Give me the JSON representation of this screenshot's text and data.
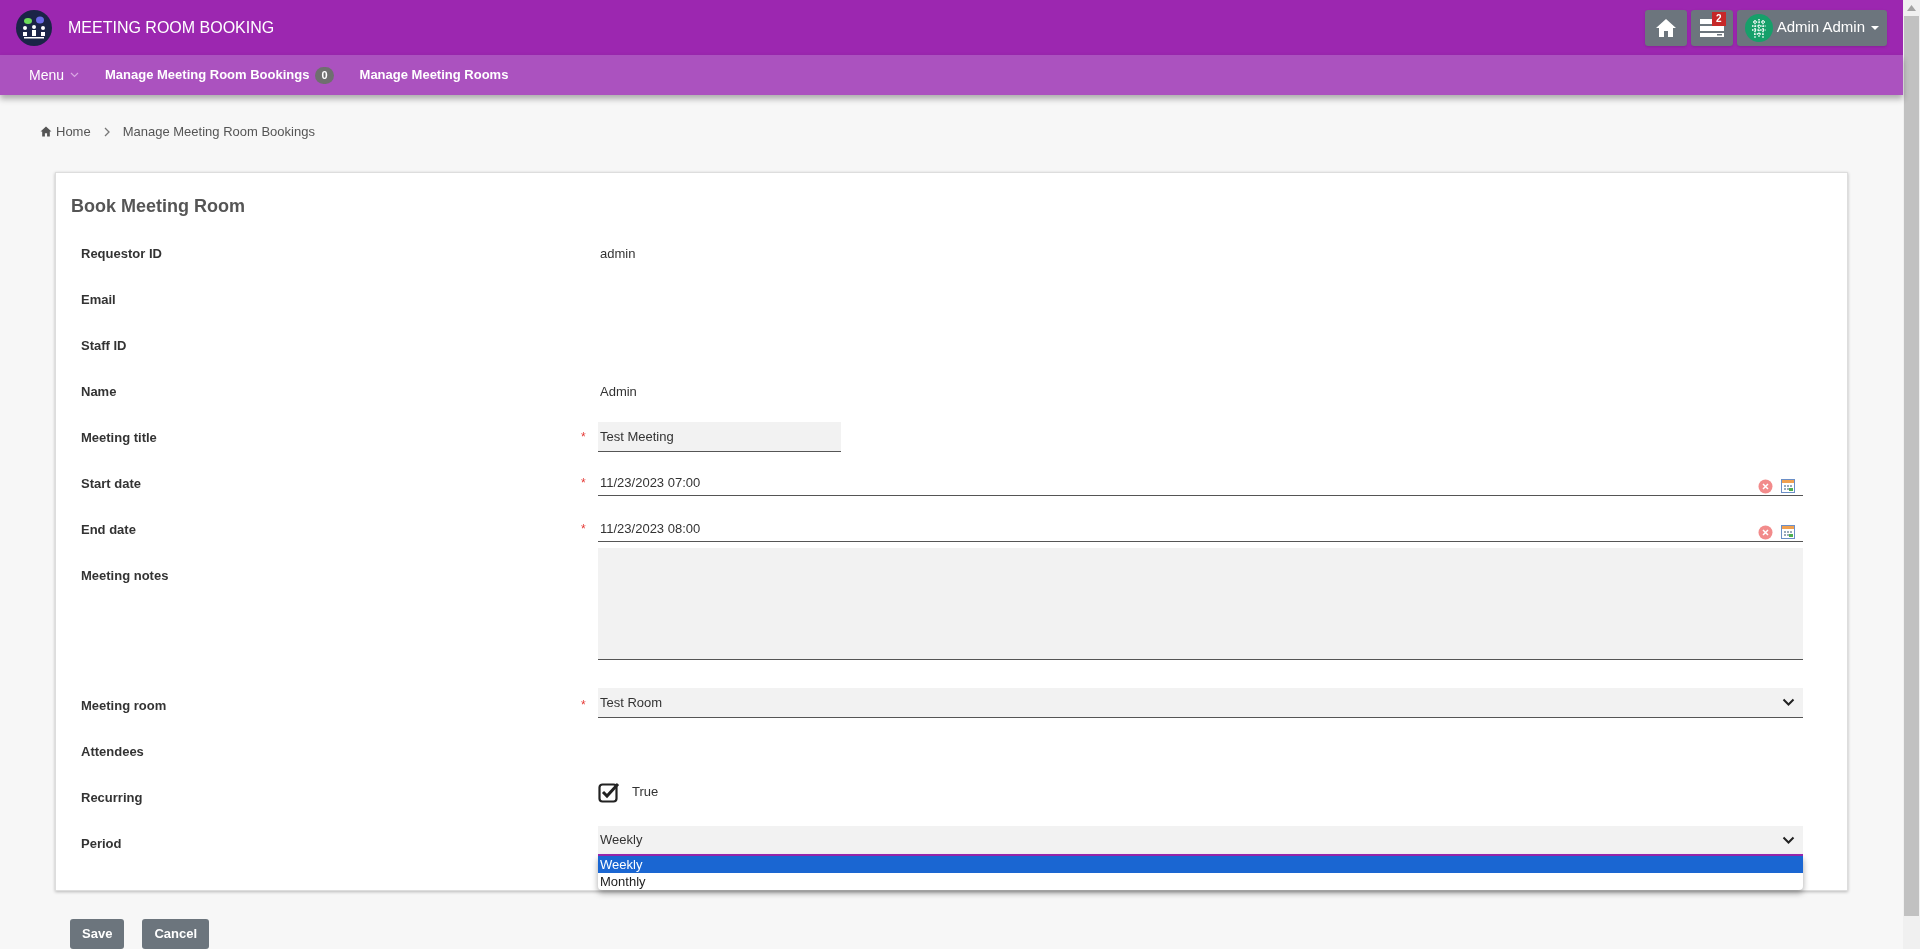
{
  "app": {
    "title": "MEETING ROOM BOOKING",
    "notification_count": "2",
    "user": "Admin Admin"
  },
  "nav": [
    {
      "label": "Menu",
      "kind": "dropdown"
    },
    {
      "label": "Manage Meeting Room Bookings",
      "kind": "link",
      "badge": "0"
    },
    {
      "label": "Manage Meeting Rooms",
      "kind": "link"
    }
  ],
  "breadcrumb": [
    "Home",
    "Manage Meeting Room Bookings"
  ],
  "form": {
    "title": "Book Meeting Room",
    "fields": [
      {
        "label": "Requestor ID",
        "kind": "text",
        "value": "admin"
      },
      {
        "label": "Email",
        "kind": "text"
      },
      {
        "label": "Staff ID",
        "kind": "text"
      },
      {
        "label": "Name",
        "kind": "text",
        "value": "Admin"
      },
      {
        "label": "Meeting title",
        "kind": "input",
        "required_mark": "*",
        "value": "Test Meeting"
      },
      {
        "label": "Start date",
        "kind": "datetime",
        "required_mark": "*",
        "value": "11/23/2023 07:00"
      },
      {
        "label": "End date",
        "kind": "datetime",
        "required_mark": "*",
        "value": "11/23/2023 08:00"
      },
      {
        "label": "Meeting notes",
        "kind": "textarea"
      },
      {
        "label": "Meeting room",
        "kind": "select",
        "required_mark": "*",
        "value": "Test Room"
      },
      {
        "label": "Attendees",
        "kind": "text"
      },
      {
        "label": "Recurring",
        "kind": "checkbox",
        "checked": true,
        "value": "True"
      },
      {
        "label": "Period",
        "kind": "select",
        "value": "Weekly",
        "expanded": true,
        "options": [
          {
            "label": "Weekly",
            "selected": true
          },
          {
            "label": "Monthly",
            "selected": false
          }
        ]
      }
    ]
  },
  "buttons": [
    "Save",
    "Cancel"
  ]
}
